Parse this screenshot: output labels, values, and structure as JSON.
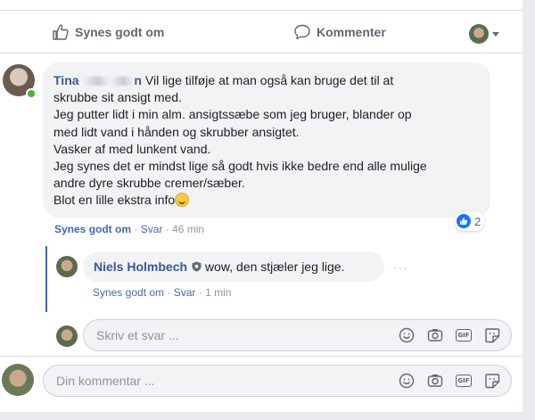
{
  "actions": {
    "like_label": "Synes godt om",
    "comment_label": "Kommenter",
    "like_icon": "thumbs-up-icon",
    "comment_icon": "speech-bubble-icon"
  },
  "comment": {
    "author": "Tina",
    "author_suffix": "n",
    "text_first": "Vil lige tilføje at man også kan bruge det til at",
    "lines": [
      "skrubbe sit ansigt med.",
      "Jeg putter lidt i min alm. ansigtssæbe som jeg bruger, blander op",
      "med lidt vand i hånden og skrubber ansigtet.",
      "Vasker af med lunkent vand.",
      "Jeg synes det er mindst lige så godt hvis ikke bedre end alle mulige",
      "andre dyre skrubbe cremer/sæber."
    ],
    "last_line": "Blot en lille ekstra info",
    "reaction_count": "2",
    "like_link": "Synes godt om",
    "reply_link": "Svar",
    "time": "46 min",
    "separator": "·"
  },
  "reply": {
    "author": "Niels Holmbech",
    "text": "wow, den stjæler jeg lige.",
    "more": "···",
    "like_link": "Synes godt om",
    "reply_link": "Svar",
    "time": "1 min",
    "separator": "·"
  },
  "reply_input": {
    "placeholder": "Skriv et svar ..."
  },
  "comment_input": {
    "placeholder": "Din kommentar ..."
  },
  "input_icons": [
    "emoji-icon",
    "camera-icon",
    "gif-icon",
    "sticker-icon"
  ],
  "gif_label": "GIF",
  "colors": {
    "link": "#385898",
    "meta_link": "#4267b2",
    "like_blue": "#1877f2",
    "online": "#42b72a"
  }
}
